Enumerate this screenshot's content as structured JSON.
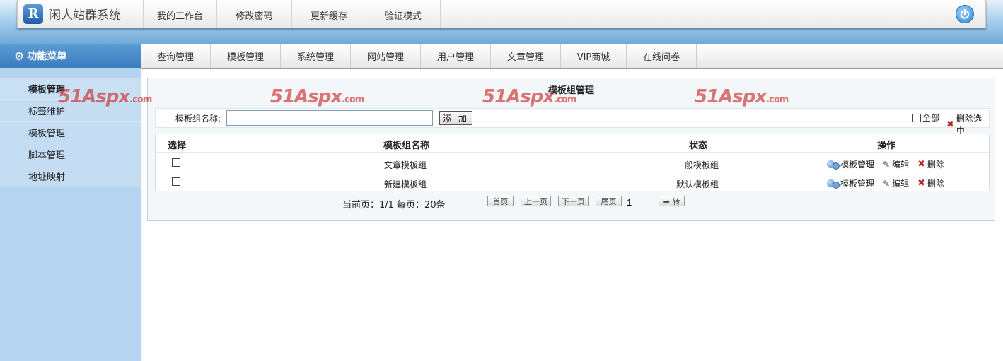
{
  "app": {
    "logo_letter": "R",
    "title": "闲人站群系统"
  },
  "top_nav": [
    "我的工作台",
    "修改密码",
    "更新缓存",
    "验证模式"
  ],
  "menu_title": "功能菜单",
  "sub_nav": [
    "查询管理",
    "模板管理",
    "系统管理",
    "网站管理",
    "用户管理",
    "文章管理",
    "VIP商城",
    "在线问卷"
  ],
  "sidebar": {
    "items": [
      {
        "label": "模板管理",
        "active": true
      },
      {
        "label": "标签维护",
        "active": false
      },
      {
        "label": "模板管理",
        "active": false
      },
      {
        "label": "脚本管理",
        "active": false
      },
      {
        "label": "地址映射",
        "active": false
      }
    ]
  },
  "panel": {
    "title": "模板组管理",
    "search_label": "模板组名称:",
    "search_value": "",
    "add_label": "添 加",
    "select_all_label": "全部",
    "delete_selected_label": "删除选中"
  },
  "table": {
    "headers": {
      "select": "选择",
      "name": "模板组名称",
      "status": "状态",
      "actions": "操作"
    },
    "rows": [
      {
        "name": "文章模板组",
        "status": "一般模板组"
      },
      {
        "name": "新建模板组",
        "status": "默认模板组"
      }
    ],
    "actions": {
      "manage": "模板管理",
      "edit": "编辑",
      "delete": "删除"
    }
  },
  "pager": {
    "info": "当前页：1/1  每页：20条",
    "first": "首页",
    "prev": "上一页",
    "next": "下一页",
    "last": "尾页",
    "page_value": "1",
    "go": "➡ 转"
  },
  "watermark": {
    "main": "51Aspx",
    "suffix": ".com"
  },
  "colors": {
    "header_blue": "#6fa9d8",
    "sidebar_bg": "#b5d4ef",
    "menu_title_bg": "#3a7dbf",
    "delete_red": "#b22222"
  },
  "icons": {
    "logo": "r-logo-icon",
    "power": "power-icon",
    "gear": "gear-icon",
    "manage": "template-manage-icon",
    "edit": "pencil-icon",
    "delete": "x-icon"
  }
}
